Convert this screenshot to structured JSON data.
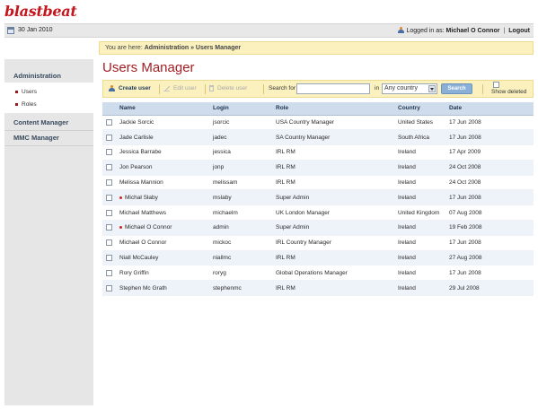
{
  "brand": {
    "logo_text": "blastbeat"
  },
  "topbar": {
    "date": "30 Jan 2010",
    "logged_in_label": "Logged in as:",
    "user_name": "Michael O Connor",
    "separator": "|",
    "logout_label": "Logout"
  },
  "breadcrumb": {
    "prefix": "You are here:",
    "path": "Administration » Users Manager"
  },
  "sidebar": {
    "header": "Administration",
    "subitems": [
      {
        "label": "Users"
      },
      {
        "label": "Roles"
      }
    ],
    "sections": [
      {
        "label": "Content Manager"
      },
      {
        "label": "MMC Manager"
      }
    ]
  },
  "page": {
    "title": "Users Manager"
  },
  "toolbar": {
    "create_label": "Create user",
    "edit_label": "Edit user",
    "delete_label": "Delete user",
    "search_label": "Search for",
    "search_value": "",
    "in_label": "in",
    "country_selected": "Any country",
    "search_button": "Search",
    "show_deleted_label": "Show deleted"
  },
  "table": {
    "columns": [
      "Name",
      "Login",
      "Role",
      "Country",
      "Date"
    ],
    "rows": [
      {
        "name": "Jackie Sorcic",
        "login": "jsorcic",
        "role": "USA Country Manager",
        "country": "United States",
        "date": "17 Jun 2008",
        "flag": false
      },
      {
        "name": "Jade Carlisle",
        "login": "jadec",
        "role": "SA Country Manager",
        "country": "South Africa",
        "date": "17 Jun 2008",
        "flag": false
      },
      {
        "name": "Jessica Barrabe",
        "login": "jessica",
        "role": "IRL RM",
        "country": "Ireland",
        "date": "17 Apr 2009",
        "flag": false
      },
      {
        "name": "Jon Pearson",
        "login": "jonp",
        "role": "IRL RM",
        "country": "Ireland",
        "date": "24 Oct 2008",
        "flag": false
      },
      {
        "name": "Melissa Mannion",
        "login": "melissam",
        "role": "IRL RM",
        "country": "Ireland",
        "date": "24 Oct 2008",
        "flag": false
      },
      {
        "name": "Michał Słaby",
        "login": "mslaby",
        "role": "Super Admin",
        "country": "Ireland",
        "date": "17 Jun 2008",
        "flag": true
      },
      {
        "name": "Michael Matthews",
        "login": "michaelm",
        "role": "UK London Manager",
        "country": "United Kingdom",
        "date": "07 Aug 2008",
        "flag": false
      },
      {
        "name": "Michael O Connor",
        "login": "admin",
        "role": "Super Admin",
        "country": "Ireland",
        "date": "19 Feb 2008",
        "flag": true
      },
      {
        "name": "Michael O Connor",
        "login": "mickoc",
        "role": "IRL Country Manager",
        "country": "Ireland",
        "date": "17 Jun 2008",
        "flag": false
      },
      {
        "name": "Niall McCauley",
        "login": "niallmc",
        "role": "IRL RM",
        "country": "Ireland",
        "date": "27 Aug 2008",
        "flag": false
      },
      {
        "name": "Rory Griffin",
        "login": "roryg",
        "role": "Global Operations Manager",
        "country": "Ireland",
        "date": "17 Jun 2008",
        "flag": false
      },
      {
        "name": "Stephen Mc Grath",
        "login": "stephenmc",
        "role": "IRL RM",
        "country": "Ireland",
        "date": "29 Jul 2008",
        "flag": false
      }
    ]
  },
  "colors": {
    "brand_red": "#c4161c",
    "title_red": "#a11f24",
    "notice_yellow": "#fbf1bf",
    "header_blue": "#cfdceb"
  }
}
